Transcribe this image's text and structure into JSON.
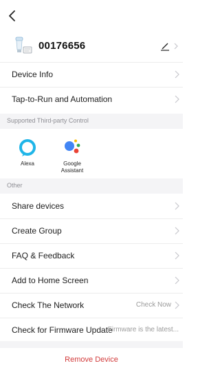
{
  "header": {
    "back_icon": "chevron-left-icon",
    "device_name": "00176656",
    "edit_icon": "pencil-icon"
  },
  "rows_top": [
    {
      "label": "Device Info"
    },
    {
      "label": "Tap-to-Run and Automation"
    }
  ],
  "third_party": {
    "section_title": "Supported Third-party Control",
    "items": [
      {
        "name": "Alexa",
        "icon": "alexa-icon"
      },
      {
        "name": "Google Assistant",
        "icon": "google-assistant-icon"
      }
    ]
  },
  "other": {
    "section_title": "Other",
    "rows": [
      {
        "label": "Share devices",
        "value": ""
      },
      {
        "label": "Create Group",
        "value": ""
      },
      {
        "label": "FAQ & Feedback",
        "value": ""
      },
      {
        "label": "Add to Home Screen",
        "value": ""
      },
      {
        "label": "Check The Network",
        "value": "Check Now"
      },
      {
        "label": "Check for Firmware Update",
        "value": "Firmware is the latest..."
      }
    ]
  },
  "remove_device": "Remove Device",
  "colors": {
    "accent_red": "#d23b3b",
    "section_bg": "#f4f4f6",
    "alexa_blue": "#1fb5e8"
  }
}
